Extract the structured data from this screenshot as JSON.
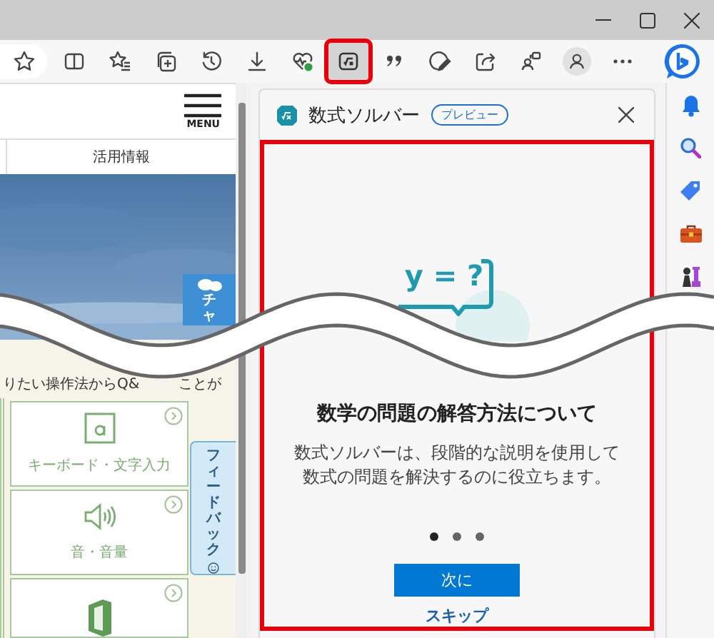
{
  "toolbar": {
    "items": [
      {
        "kind": "star",
        "selected": false
      },
      {
        "kind": "split",
        "selected": false
      },
      {
        "kind": "favorites",
        "selected": false
      },
      {
        "kind": "collections",
        "selected": false
      },
      {
        "kind": "history",
        "selected": false
      },
      {
        "kind": "download",
        "selected": false
      },
      {
        "kind": "health",
        "selected": false
      },
      {
        "kind": "math",
        "selected": true
      },
      {
        "kind": "quote",
        "selected": false
      },
      {
        "kind": "draw",
        "selected": false
      },
      {
        "kind": "share",
        "selected": false
      },
      {
        "kind": "workspaces",
        "selected": false
      },
      {
        "kind": "profile",
        "selected": false
      },
      {
        "kind": "more",
        "selected": false
      }
    ]
  },
  "page": {
    "menu_label": "MENU",
    "tab": "活用情報",
    "chat_label": "チャ",
    "intro": [
      "りたい操作法からQ&",
      "ことが"
    ],
    "cards": [
      {
        "kind": "keyboard",
        "label": "キーボード・文字入力"
      },
      {
        "kind": "sound",
        "label": "音・音量"
      },
      {
        "kind": "office"
      }
    ],
    "feedback": "フィードバック"
  },
  "panel": {
    "title": "数式ソルバー",
    "badge": "プレビュー",
    "illustration_text": "y = ?",
    "heading": "数学の問題の解答方法について",
    "description": "数式ソルバーは、段階的な説明を使用して数式の問題を解決するのに役立ちます。",
    "dots": [
      {
        "selected": true
      },
      {
        "selected": false
      },
      {
        "selected": false
      }
    ],
    "next_button": "次に",
    "skip_link": "スキップ"
  },
  "sidebar": {
    "items": [
      {
        "kind": "bell"
      },
      {
        "kind": "search"
      },
      {
        "kind": "tag"
      },
      {
        "kind": "toolbox"
      },
      {
        "kind": "games"
      }
    ]
  }
}
